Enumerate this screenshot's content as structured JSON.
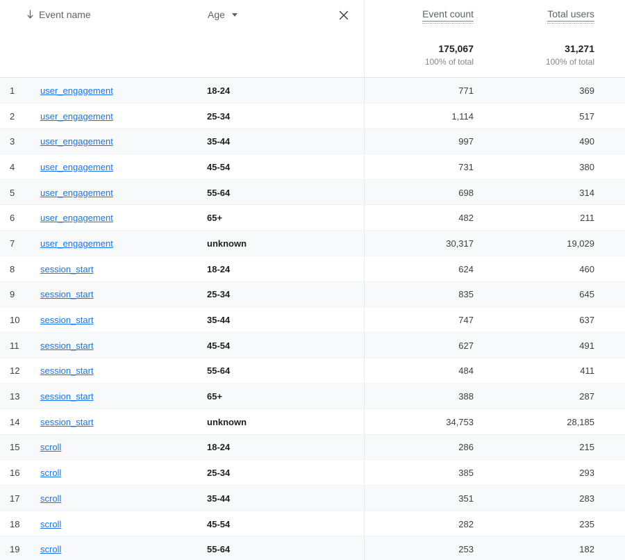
{
  "table": {
    "dimension_headers": {
      "event_name": {
        "label": "Event name",
        "sort_icon": "sort-descending-arrow-icon",
        "sort_direction": "descending"
      },
      "age": {
        "label": "Age",
        "dropdown_icon": "chevron-down-icon",
        "remove_icon": "close-icon"
      }
    },
    "metric_headers": [
      {
        "label": "Event count",
        "total": "175,067",
        "total_subtext": "100% of total"
      },
      {
        "label": "Total users",
        "total": "31,271",
        "total_subtext": "100% of total"
      }
    ],
    "colors": {
      "link": "#1a73e8",
      "text_primary": "#202124",
      "text_secondary": "#5f6368",
      "row_alt_background": "#f8f9fa",
      "row_background": "#ffffff",
      "divider": "#e8eaed"
    },
    "rows": [
      {
        "index": "1",
        "event": "user_engagement",
        "age": "18-24",
        "event_count": "771",
        "total_users": "369"
      },
      {
        "index": "2",
        "event": "user_engagement",
        "age": "25-34",
        "event_count": "1,114",
        "total_users": "517"
      },
      {
        "index": "3",
        "event": "user_engagement",
        "age": "35-44",
        "event_count": "997",
        "total_users": "490"
      },
      {
        "index": "4",
        "event": "user_engagement",
        "age": "45-54",
        "event_count": "731",
        "total_users": "380"
      },
      {
        "index": "5",
        "event": "user_engagement",
        "age": "55-64",
        "event_count": "698",
        "total_users": "314"
      },
      {
        "index": "6",
        "event": "user_engagement",
        "age": "65+",
        "event_count": "482",
        "total_users": "211"
      },
      {
        "index": "7",
        "event": "user_engagement",
        "age": "unknown",
        "event_count": "30,317",
        "total_users": "19,029"
      },
      {
        "index": "8",
        "event": "session_start",
        "age": "18-24",
        "event_count": "624",
        "total_users": "460"
      },
      {
        "index": "9",
        "event": "session_start",
        "age": "25-34",
        "event_count": "835",
        "total_users": "645"
      },
      {
        "index": "10",
        "event": "session_start",
        "age": "35-44",
        "event_count": "747",
        "total_users": "637"
      },
      {
        "index": "11",
        "event": "session_start",
        "age": "45-54",
        "event_count": "627",
        "total_users": "491"
      },
      {
        "index": "12",
        "event": "session_start",
        "age": "55-64",
        "event_count": "484",
        "total_users": "411"
      },
      {
        "index": "13",
        "event": "session_start",
        "age": "65+",
        "event_count": "388",
        "total_users": "287"
      },
      {
        "index": "14",
        "event": "session_start",
        "age": "unknown",
        "event_count": "34,753",
        "total_users": "28,185"
      },
      {
        "index": "15",
        "event": "scroll",
        "age": "18-24",
        "event_count": "286",
        "total_users": "215"
      },
      {
        "index": "16",
        "event": "scroll",
        "age": "25-34",
        "event_count": "385",
        "total_users": "293"
      },
      {
        "index": "17",
        "event": "scroll",
        "age": "35-44",
        "event_count": "351",
        "total_users": "283"
      },
      {
        "index": "18",
        "event": "scroll",
        "age": "45-54",
        "event_count": "282",
        "total_users": "235"
      },
      {
        "index": "19",
        "event": "scroll",
        "age": "55-64",
        "event_count": "253",
        "total_users": "182"
      }
    ]
  }
}
